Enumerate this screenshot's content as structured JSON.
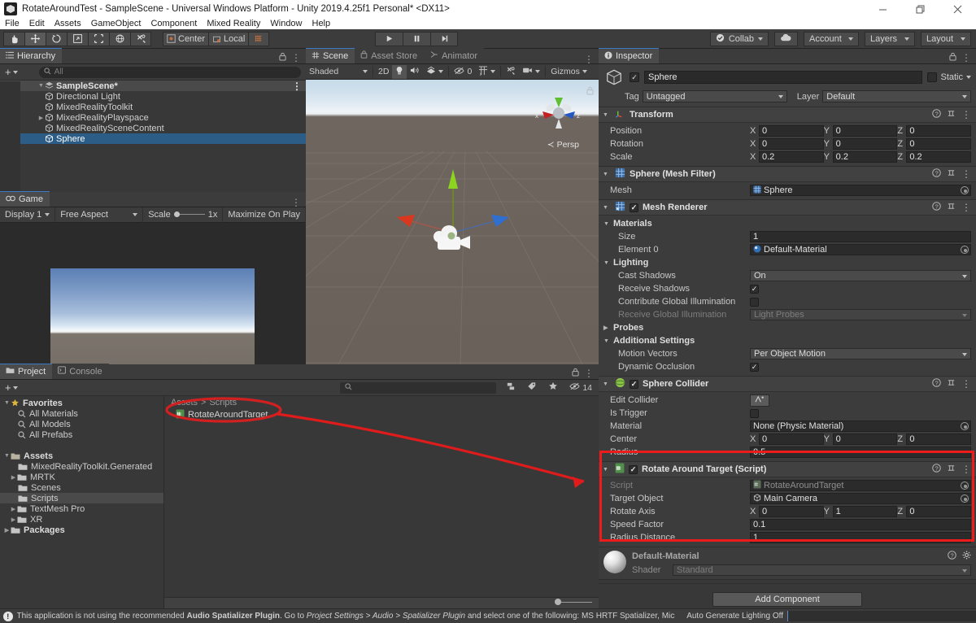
{
  "window": {
    "title": "RotateAroundTest - SampleScene - Universal Windows Platform - Unity 2019.4.25f1 Personal* <DX11>",
    "minimize": "─",
    "maximize": "❐",
    "close": "✕"
  },
  "menu": {
    "items": [
      "File",
      "Edit",
      "Assets",
      "GameObject",
      "Component",
      "Mixed Reality",
      "Window",
      "Help"
    ]
  },
  "toolbar": {
    "tools": [
      "hand-tool",
      "move-tool",
      "rotate-tool",
      "scale-tool",
      "rect-tool",
      "transform-tool",
      "custom-tool"
    ],
    "pivot_mode": "Center",
    "pivot_rotation": "Local",
    "play": "▶",
    "pause": "‖",
    "step": "▶|",
    "collab": "Collab",
    "cloud": "cloud-icon",
    "account": "Account",
    "layers": "Layers",
    "layout": "Layout"
  },
  "hierarchy": {
    "tab": "Hierarchy",
    "search_placeholder": "All",
    "create_label": "+",
    "items": [
      {
        "label": "SampleScene*",
        "depth": 0,
        "type": "scene",
        "expanded": true,
        "selected": false
      },
      {
        "label": "Directional Light",
        "depth": 1,
        "type": "gameobject",
        "expanded": null,
        "selected": false
      },
      {
        "label": "MixedRealityToolkit",
        "depth": 1,
        "type": "gameobject",
        "expanded": null,
        "selected": false
      },
      {
        "label": "MixedRealityPlayspace",
        "depth": 1,
        "type": "gameobject",
        "expanded": false,
        "selected": false
      },
      {
        "label": "MixedRealitySceneContent",
        "depth": 1,
        "type": "gameobject",
        "expanded": null,
        "selected": false
      },
      {
        "label": "Sphere",
        "depth": 1,
        "type": "gameobject",
        "expanded": null,
        "selected": true
      }
    ]
  },
  "scene_panel": {
    "tabs": [
      {
        "label": "Scene",
        "selected": true,
        "icon": "grid-icon"
      },
      {
        "label": "Asset Store",
        "selected": false,
        "icon": "store-icon"
      },
      {
        "label": "Animator",
        "selected": false,
        "icon": "animator-icon"
      }
    ],
    "draw_mode": "Shaded",
    "two_d": "2D",
    "lighting": "lightbulb-icon",
    "audio": "audio-icon",
    "fx": "fx-icon",
    "hidden_count": "0",
    "grid": "grid-visibility-icon",
    "tools": "scene-tools-icon",
    "camera": "scene-camera-icon",
    "gizmos": "Gizmos",
    "view_label": "Persp",
    "axis_labels": {
      "x": "x",
      "y": "y",
      "z": "z"
    }
  },
  "game_panel": {
    "tab": "Game",
    "display": "Display 1",
    "aspect": "Free Aspect",
    "scale_label": "Scale",
    "scale_value": "1x",
    "maximize": "Maximize On Play"
  },
  "project_panel": {
    "tabs": [
      {
        "label": "Project",
        "selected": true
      },
      {
        "label": "Console",
        "selected": false
      }
    ],
    "create_label": "+",
    "search_placeholder": "",
    "hidden_count": "14",
    "breadcrumb": [
      "Assets",
      "Scripts"
    ],
    "tree": [
      {
        "label": "Favorites",
        "depth": 0,
        "icon": "star-icon",
        "bold": true,
        "arrow": "down",
        "selected": false
      },
      {
        "label": "All Materials",
        "depth": 1,
        "icon": "search-icon",
        "bold": false,
        "arrow": null,
        "selected": false
      },
      {
        "label": "All Models",
        "depth": 1,
        "icon": "search-icon",
        "bold": false,
        "arrow": null,
        "selected": false
      },
      {
        "label": "All Prefabs",
        "depth": 1,
        "icon": "search-icon",
        "bold": false,
        "arrow": null,
        "selected": false
      },
      {
        "label": "",
        "depth": 0,
        "icon": null,
        "bold": false,
        "arrow": null,
        "selected": false
      },
      {
        "label": "Assets",
        "depth": 0,
        "icon": "folder-open-icon",
        "bold": true,
        "arrow": "down",
        "selected": false
      },
      {
        "label": "MixedRealityToolkit.Generated",
        "depth": 1,
        "icon": "folder-icon",
        "bold": false,
        "arrow": null,
        "selected": false
      },
      {
        "label": "MRTK",
        "depth": 1,
        "icon": "folder-icon",
        "bold": false,
        "arrow": "right",
        "selected": false
      },
      {
        "label": "Scenes",
        "depth": 1,
        "icon": "folder-icon",
        "bold": false,
        "arrow": null,
        "selected": false
      },
      {
        "label": "Scripts",
        "depth": 1,
        "icon": "folder-icon",
        "bold": false,
        "arrow": null,
        "selected": true
      },
      {
        "label": "TextMesh Pro",
        "depth": 1,
        "icon": "folder-icon",
        "bold": false,
        "arrow": "right",
        "selected": false
      },
      {
        "label": "XR",
        "depth": 1,
        "icon": "folder-icon",
        "bold": false,
        "arrow": "right",
        "selected": false
      },
      {
        "label": "Packages",
        "depth": 0,
        "icon": "folder-icon",
        "bold": true,
        "arrow": "right",
        "selected": false
      }
    ],
    "assets": [
      {
        "label": "RotateAroundTarget",
        "icon": "cs-script-icon"
      }
    ]
  },
  "inspector": {
    "tab": "Inspector",
    "object_name": "Sphere",
    "enabled": true,
    "static_label": "Static",
    "tag_label": "Tag",
    "tag_value": "Untagged",
    "layer_label": "Layer",
    "layer_value": "Default",
    "components": [
      {
        "name": "Transform",
        "icon": "transform-icon",
        "has_checkbox": false,
        "rows": [
          {
            "label": "Position",
            "type": "vector3",
            "x": "0",
            "y": "0",
            "z": "0"
          },
          {
            "label": "Rotation",
            "type": "vector3",
            "x": "0",
            "y": "0",
            "z": "0"
          },
          {
            "label": "Scale",
            "type": "vector3",
            "x": "0.2",
            "y": "0.2",
            "z": "0.2"
          }
        ]
      },
      {
        "name": "Sphere (Mesh Filter)",
        "icon": "mesh-filter-icon",
        "has_checkbox": false,
        "rows": [
          {
            "label": "Mesh",
            "type": "object",
            "value": "Sphere"
          }
        ]
      },
      {
        "name": "Mesh Renderer",
        "icon": "mesh-renderer-icon",
        "has_checkbox": true,
        "checked": true,
        "rows": [
          {
            "label": "Materials",
            "type": "foldout",
            "expanded": true
          },
          {
            "label": "Size",
            "type": "text",
            "value": "1",
            "indent": 2
          },
          {
            "label": "Element 0",
            "type": "object",
            "value": "Default-Material",
            "indent": 2
          },
          {
            "label": "Lighting",
            "type": "foldout",
            "expanded": true
          },
          {
            "label": "Cast Shadows",
            "type": "dropdown",
            "value": "On",
            "indent": 2
          },
          {
            "label": "Receive Shadows",
            "type": "checkbox",
            "checked": true,
            "indent": 2
          },
          {
            "label": "Contribute Global Illumination",
            "type": "checkbox",
            "checked": false,
            "indent": 2
          },
          {
            "label": "Receive Global Illumination",
            "type": "dropdown",
            "value": "Light Probes",
            "indent": 2,
            "disabled": true
          },
          {
            "label": "Probes",
            "type": "foldout",
            "expanded": false
          },
          {
            "label": "Additional Settings",
            "type": "foldout",
            "expanded": true
          },
          {
            "label": "Motion Vectors",
            "type": "dropdown",
            "value": "Per Object Motion",
            "indent": 2
          },
          {
            "label": "Dynamic Occlusion",
            "type": "checkbox",
            "checked": true,
            "indent": 2
          }
        ]
      },
      {
        "name": "Sphere Collider",
        "icon": "collider-icon",
        "has_checkbox": true,
        "checked": true,
        "rows": [
          {
            "label": "Edit Collider",
            "type": "button",
            "value": "edit-collider-icon"
          },
          {
            "label": "Is Trigger",
            "type": "checkbox",
            "checked": false
          },
          {
            "label": "Material",
            "type": "object",
            "value": "None (Physic Material)"
          },
          {
            "label": "Center",
            "type": "vector3",
            "x": "0",
            "y": "0",
            "z": "0"
          },
          {
            "label": "Radius",
            "type": "text",
            "value": "0.5"
          }
        ]
      },
      {
        "name": "Rotate Around Target (Script)",
        "icon": "cs-script-icon",
        "has_checkbox": true,
        "checked": true,
        "highlighted": true,
        "rows": [
          {
            "label": "Script",
            "type": "object",
            "value": "RotateAroundTarget",
            "disabled": true
          },
          {
            "label": "Target Object",
            "type": "object",
            "value": "Main Camera"
          },
          {
            "label": "Rotate Axis",
            "type": "vector3",
            "x": "0",
            "y": "1",
            "z": "0"
          },
          {
            "label": "Speed Factor",
            "type": "text",
            "value": "0.1"
          },
          {
            "label": "Radius Distance",
            "type": "text",
            "value": "1"
          }
        ]
      }
    ],
    "material_preview": {
      "name": "Default-Material",
      "shader_label": "Shader",
      "shader_value": "Standard"
    },
    "add_component": "Add Component"
  },
  "status_bar": {
    "message_parts": [
      {
        "text": "This application is not using the recommended ",
        "style": "normal"
      },
      {
        "text": "Audio Spatializer Plugin",
        "style": "bold"
      },
      {
        "text": ". Go to ",
        "style": "normal"
      },
      {
        "text": "Project Settings > Audio > Spatializer Plugin",
        "style": "italic"
      },
      {
        "text": " and select one of the following: MS HRTF Spatializer, Microsoft S",
        "style": "normal"
      }
    ],
    "auto_generate_lighting": "Auto Generate Lighting Off"
  },
  "colors": {
    "accent_blue": "#2c5d87",
    "highlight_red": "#ee1b1b",
    "panel_bg": "#383838",
    "header_bg": "#3c3c3c",
    "toolbar_bg": "#4b4b4b"
  }
}
